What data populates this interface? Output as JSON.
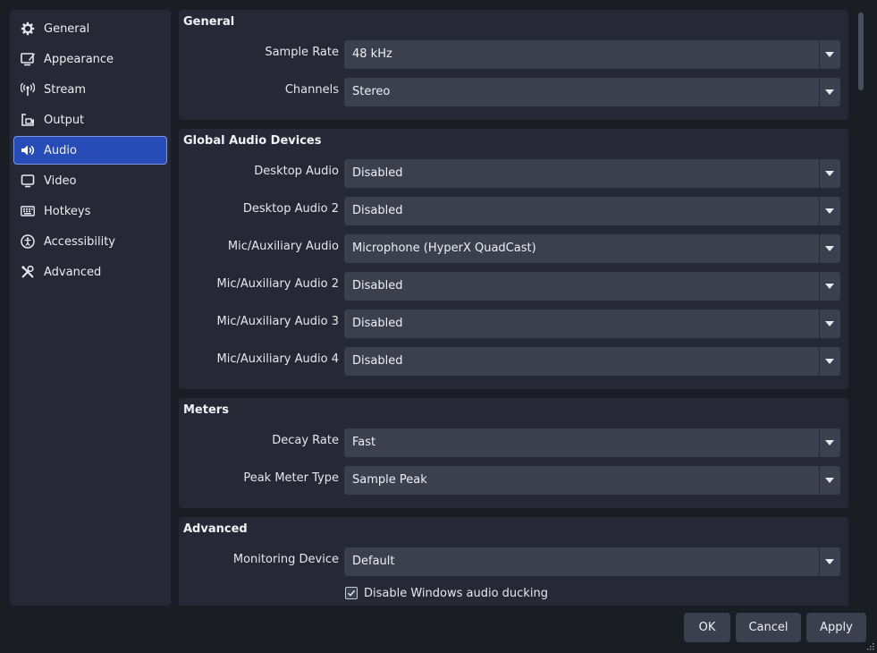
{
  "sidebar": {
    "items": [
      {
        "label": "General",
        "icon": "gear-icon"
      },
      {
        "label": "Appearance",
        "icon": "appearance-icon"
      },
      {
        "label": "Stream",
        "icon": "antenna-icon"
      },
      {
        "label": "Output",
        "icon": "output-icon"
      },
      {
        "label": "Audio",
        "icon": "speaker-icon",
        "active": true
      },
      {
        "label": "Video",
        "icon": "monitor-icon"
      },
      {
        "label": "Hotkeys",
        "icon": "keyboard-icon"
      },
      {
        "label": "Accessibility",
        "icon": "accessibility-icon"
      },
      {
        "label": "Advanced",
        "icon": "tools-icon"
      }
    ]
  },
  "general": {
    "title": "General",
    "sample_rate": {
      "label": "Sample Rate",
      "value": "48 kHz"
    },
    "channels": {
      "label": "Channels",
      "value": "Stereo"
    }
  },
  "global_devices": {
    "title": "Global Audio Devices",
    "rows": [
      {
        "label": "Desktop Audio",
        "value": "Disabled"
      },
      {
        "label": "Desktop Audio 2",
        "value": "Disabled"
      },
      {
        "label": "Mic/Auxiliary Audio",
        "value": "Microphone (HyperX QuadCast)"
      },
      {
        "label": "Mic/Auxiliary Audio 2",
        "value": "Disabled"
      },
      {
        "label": "Mic/Auxiliary Audio 3",
        "value": "Disabled"
      },
      {
        "label": "Mic/Auxiliary Audio 4",
        "value": "Disabled"
      }
    ]
  },
  "meters": {
    "title": "Meters",
    "decay_rate": {
      "label": "Decay Rate",
      "value": "Fast"
    },
    "peak_meter_type": {
      "label": "Peak Meter Type",
      "value": "Sample Peak"
    }
  },
  "advanced": {
    "title": "Advanced",
    "monitoring_device": {
      "label": "Monitoring Device",
      "value": "Default"
    },
    "ducking": {
      "label": "Disable Windows audio ducking",
      "checked": true
    }
  },
  "buttons": {
    "ok": "OK",
    "cancel": "Cancel",
    "apply": "Apply"
  },
  "colors": {
    "accent": "#284cb8",
    "panel": "#262935",
    "background": "#1b1d24",
    "control": "#3b3f4e"
  }
}
